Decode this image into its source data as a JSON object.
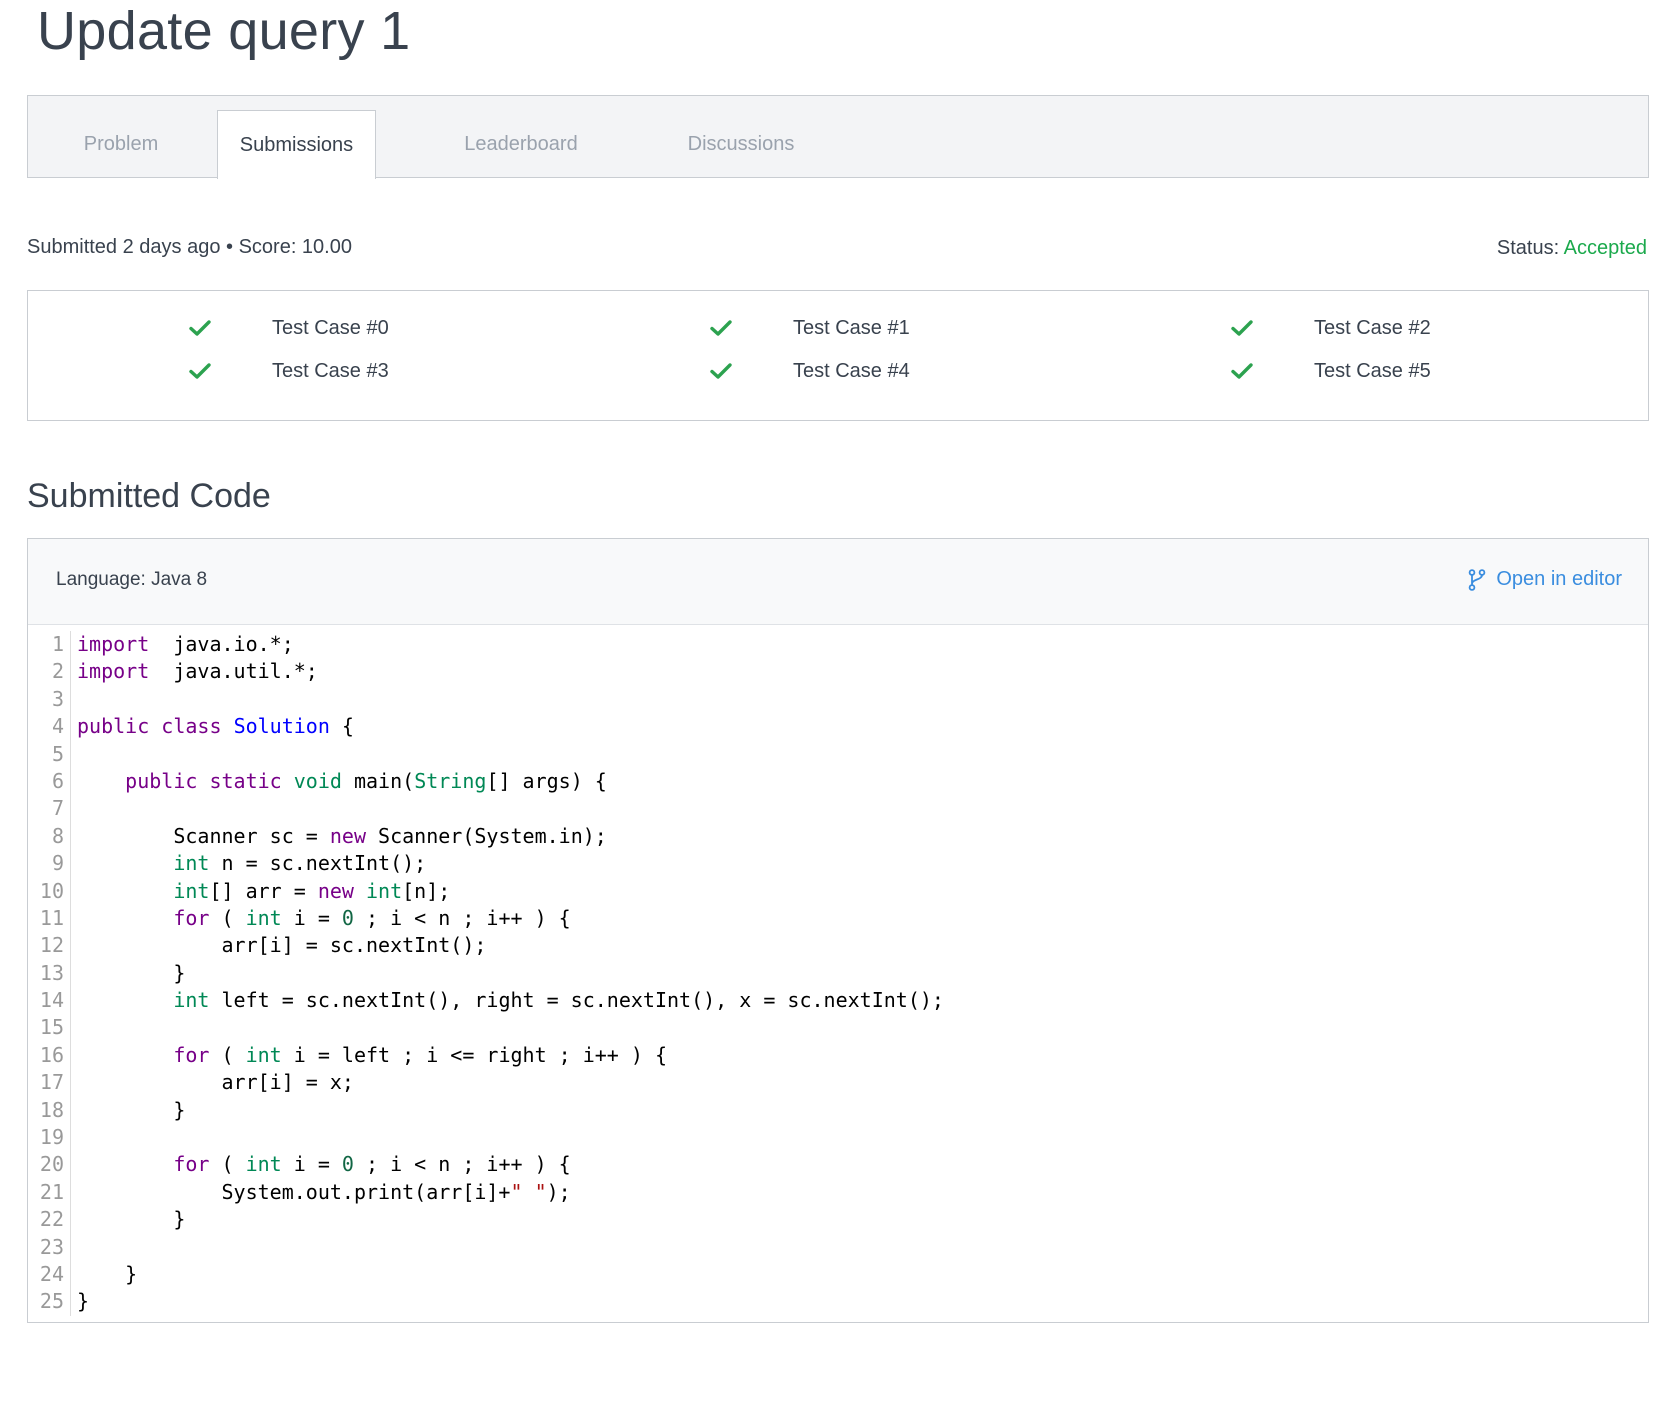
{
  "page": {
    "title": "Update query 1"
  },
  "tabs": [
    {
      "label": "Problem",
      "active": false
    },
    {
      "label": "Submissions",
      "active": true
    },
    {
      "label": "Leaderboard",
      "active": false
    },
    {
      "label": "Discussions",
      "active": false
    }
  ],
  "submission": {
    "meta": "Submitted 2 days ago • Score: 10.00",
    "status_label": "Status:",
    "status_value": "Accepted"
  },
  "test_cases": [
    {
      "label": "Test Case #0",
      "passed": true
    },
    {
      "label": "Test Case #1",
      "passed": true
    },
    {
      "label": "Test Case #2",
      "passed": true
    },
    {
      "label": "Test Case #3",
      "passed": true
    },
    {
      "label": "Test Case #4",
      "passed": true
    },
    {
      "label": "Test Case #5",
      "passed": true
    }
  ],
  "code_section": {
    "title": "Submitted Code",
    "language": "Language: Java 8",
    "open_in_editor": "Open in editor",
    "open_in_editor_icon": "git-branch-icon",
    "lines": [
      [
        [
          "kw",
          "import"
        ],
        [
          "",
          "  java.io.*;"
        ]
      ],
      [
        [
          "kw",
          "import"
        ],
        [
          "",
          "  java.util.*;"
        ]
      ],
      [],
      [
        [
          "kw",
          "public"
        ],
        [
          "",
          " "
        ],
        [
          "kw",
          "class"
        ],
        [
          "",
          " "
        ],
        [
          "def",
          "Solution"
        ],
        [
          "",
          " {"
        ]
      ],
      [],
      [
        [
          "",
          "    "
        ],
        [
          "kw",
          "public"
        ],
        [
          "",
          " "
        ],
        [
          "kw",
          "static"
        ],
        [
          "",
          " "
        ],
        [
          "type",
          "void"
        ],
        [
          "",
          " main("
        ],
        [
          "type",
          "String"
        ],
        [
          "",
          "[] args) {"
        ]
      ],
      [],
      [
        [
          "",
          "        Scanner sc = "
        ],
        [
          "kw",
          "new"
        ],
        [
          "",
          " Scanner(System.in);"
        ]
      ],
      [
        [
          "",
          "        "
        ],
        [
          "type",
          "int"
        ],
        [
          "",
          " n = sc.nextInt();"
        ]
      ],
      [
        [
          "",
          "        "
        ],
        [
          "type",
          "int"
        ],
        [
          "",
          "[] arr = "
        ],
        [
          "kw",
          "new"
        ],
        [
          "",
          " "
        ],
        [
          "type",
          "int"
        ],
        [
          "",
          "[n];"
        ]
      ],
      [
        [
          "",
          "        "
        ],
        [
          "kw",
          "for"
        ],
        [
          "",
          " ( "
        ],
        [
          "type",
          "int"
        ],
        [
          "",
          " i = "
        ],
        [
          "num",
          "0"
        ],
        [
          "",
          " ; i < n ; i++ ) {"
        ]
      ],
      [
        [
          "",
          "            arr[i] = sc.nextInt();"
        ]
      ],
      [
        [
          "",
          "        }"
        ]
      ],
      [
        [
          "",
          "        "
        ],
        [
          "type",
          "int"
        ],
        [
          "",
          " left = sc.nextInt(), right = sc.nextInt(), x = sc.nextInt();"
        ]
      ],
      [],
      [
        [
          "",
          "        "
        ],
        [
          "kw",
          "for"
        ],
        [
          "",
          " ( "
        ],
        [
          "type",
          "int"
        ],
        [
          "",
          " i = left ; i <= right ; i++ ) {"
        ]
      ],
      [
        [
          "",
          "            arr[i] = x;"
        ]
      ],
      [
        [
          "",
          "        }"
        ]
      ],
      [],
      [
        [
          "",
          "        "
        ],
        [
          "kw",
          "for"
        ],
        [
          "",
          " ( "
        ],
        [
          "type",
          "int"
        ],
        [
          "",
          " i = "
        ],
        [
          "num",
          "0"
        ],
        [
          "",
          " ; i < n ; i++ ) {"
        ]
      ],
      [
        [
          "",
          "            System.out.print(arr[i]+"
        ],
        [
          "str",
          "\" \""
        ],
        [
          "",
          ");"
        ]
      ],
      [
        [
          "",
          "        }"
        ]
      ],
      [],
      [
        [
          "",
          "    }"
        ]
      ],
      [
        [
          "",
          "}"
        ]
      ]
    ]
  },
  "colors": {
    "accent_link": "#3a8ddf",
    "success": "#1ba94c",
    "text": "#39424e",
    "muted_tab": "#9aa2ad"
  }
}
